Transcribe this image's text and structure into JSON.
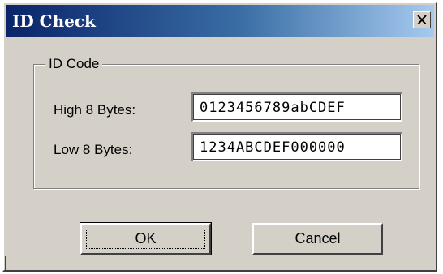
{
  "window": {
    "title": "ID Check",
    "close_icon": "close-icon"
  },
  "group": {
    "label": "ID Code",
    "fields": [
      {
        "label": "High 8 Bytes:",
        "value": "0123456789abCDEF"
      },
      {
        "label": "Low 8 Bytes:",
        "value": "1234ABCDEF000000"
      }
    ]
  },
  "buttons": {
    "ok_label": "OK",
    "cancel_label": "Cancel"
  },
  "colors": {
    "titlebar_start": "#0a246a",
    "titlebar_end": "#a6caf0",
    "dialog_face": "#d4d0c8"
  }
}
